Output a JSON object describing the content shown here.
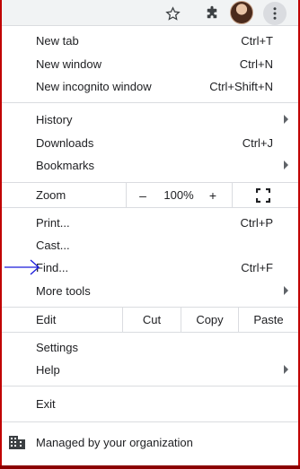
{
  "toolbar": {
    "icons": [
      "star-icon",
      "puzzle-extension-icon",
      "profile-avatar",
      "more-vert-icon"
    ]
  },
  "menu": {
    "group1": [
      {
        "label": "New tab",
        "shortcut": "Ctrl+T"
      },
      {
        "label": "New window",
        "shortcut": "Ctrl+N"
      },
      {
        "label": "New incognito window",
        "shortcut": "Ctrl+Shift+N"
      }
    ],
    "group2": [
      {
        "label": "History",
        "shortcut": ""
      },
      {
        "label": "Downloads",
        "shortcut": "Ctrl+J"
      },
      {
        "label": "Bookmarks",
        "shortcut": ""
      }
    ],
    "zoom": {
      "label": "Zoom",
      "minus": "–",
      "value": "100%",
      "plus": "+"
    },
    "group3": [
      {
        "label": "Print...",
        "shortcut": "Ctrl+P"
      },
      {
        "label": "Cast...",
        "shortcut": ""
      },
      {
        "label": "Find...",
        "shortcut": "Ctrl+F"
      },
      {
        "label": "More tools",
        "shortcut": ""
      }
    ],
    "edit": {
      "label": "Edit",
      "cut": "Cut",
      "copy": "Copy",
      "paste": "Paste"
    },
    "group4": [
      {
        "label": "Settings",
        "shortcut": ""
      },
      {
        "label": "Help",
        "shortcut": ""
      }
    ],
    "exit": {
      "label": "Exit"
    },
    "managed": {
      "label": "Managed by your organization"
    }
  },
  "colors": {
    "frame": "#c00000",
    "annotation_arrow": "#1a1adb",
    "separator": "#dadce0"
  }
}
